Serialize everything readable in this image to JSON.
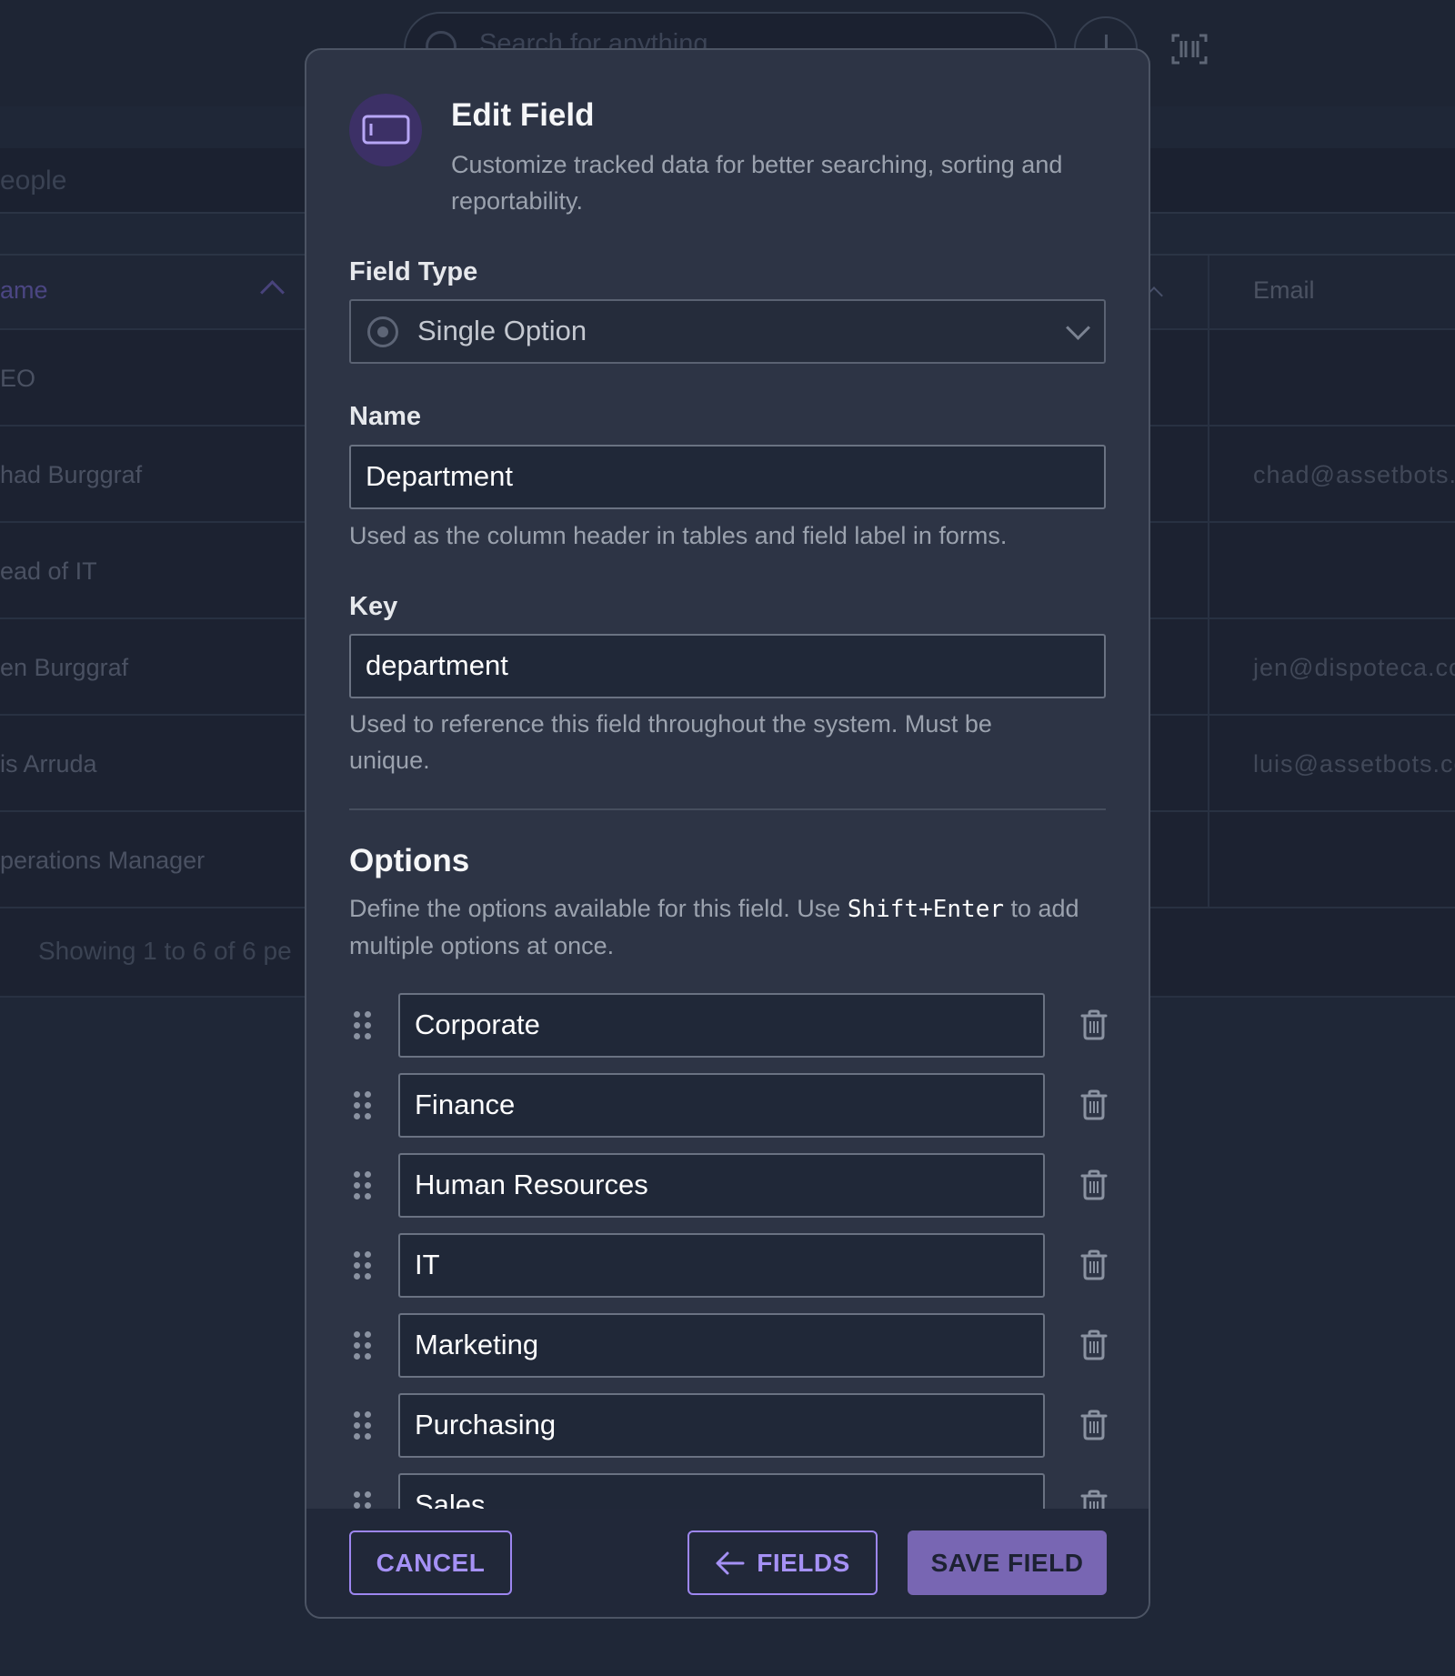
{
  "background": {
    "search": {
      "placeholder": "Search for anything"
    },
    "people_search": {
      "placeholder_visible": "eople"
    },
    "table": {
      "headers": {
        "name": "ame",
        "email": "Email"
      },
      "rows": [
        {
          "name": "EO",
          "email": ""
        },
        {
          "name": "had Burggraf",
          "email": "chad@assetbots."
        },
        {
          "name": "ead of IT",
          "email": ""
        },
        {
          "name": "en Burggraf",
          "email": "jen@dispoteca.co"
        },
        {
          "name": "is Arruda",
          "email": "luis@assetbots.co"
        },
        {
          "name": "perations Manager",
          "email": ""
        }
      ],
      "footer": "Showing 1 to 6 of 6 pe"
    }
  },
  "modal": {
    "title": "Edit Field",
    "description": "Customize tracked data for better searching, sorting and reportability.",
    "field_type": {
      "label": "Field Type",
      "value": "Single Option"
    },
    "name": {
      "label": "Name",
      "value": "Department",
      "help": "Used as the column header in tables and field label in forms."
    },
    "key": {
      "label": "Key",
      "value": "department",
      "help": "Used to reference this field throughout the system. Must be unique."
    },
    "options": {
      "title": "Options",
      "help_before": "Define the options available for this field. Use ",
      "help_code": "Shift+Enter",
      "help_after": " to add multiple options at once.",
      "items": [
        "Corporate",
        "Finance",
        "Human Resources",
        "IT",
        "Marketing",
        "Purchasing",
        "Sales"
      ]
    },
    "buttons": {
      "cancel": "CANCEL",
      "back": "FIELDS",
      "save": "SAVE FIELD"
    }
  },
  "colors": {
    "accent": "#9d86f0",
    "save_bg": "#7866b3",
    "icon_circle": "#3c3066"
  }
}
